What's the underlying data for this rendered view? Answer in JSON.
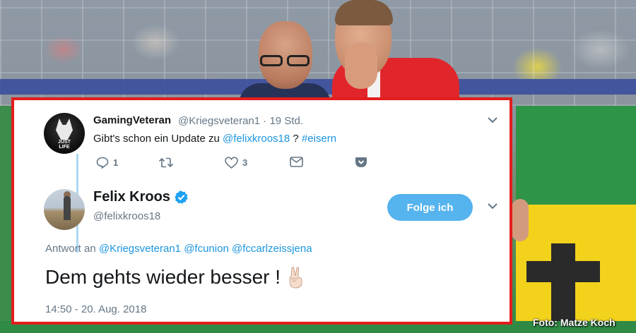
{
  "tweet_1": {
    "display_name": "GamingVeteran",
    "handle": "@Kriegsveteran1",
    "separator": "·",
    "time": "19 Std.",
    "text_prefix": "Gibt's schon ein Update zu ",
    "mention": "@felixkroos18",
    "text_middle": " ? ",
    "hashtag": "#eisern",
    "avatar_text_line1": "JUST",
    "avatar_text_line2": "LIFE",
    "replies_count": "1",
    "likes_count": "3"
  },
  "tweet_2": {
    "display_name": "Felix Kroos",
    "handle": "@felixkroos18",
    "follow_label": "Folge ich",
    "reply_to_prefix": "Antwort an",
    "reply_to_mentions": [
      "@Kriegsveteran1",
      "@fcunion",
      "@fccarlzeissjena"
    ],
    "text": "Dem gehts wieder besser !",
    "timestamp": "14:50 - 20. Aug. 2018"
  },
  "photo_credit": "Foto: Matze Koch",
  "colors": {
    "link": "#1b95e0",
    "follow_button": "#55b3ee",
    "verified": "#1da1f2",
    "frame": "#e41d1d",
    "muted": "#657786"
  },
  "icons": [
    "reply-icon",
    "retweet-icon",
    "like-icon",
    "direct-message-icon",
    "pocket-icon",
    "chevron-down-icon",
    "verified-badge-icon",
    "victory-hand-icon"
  ]
}
